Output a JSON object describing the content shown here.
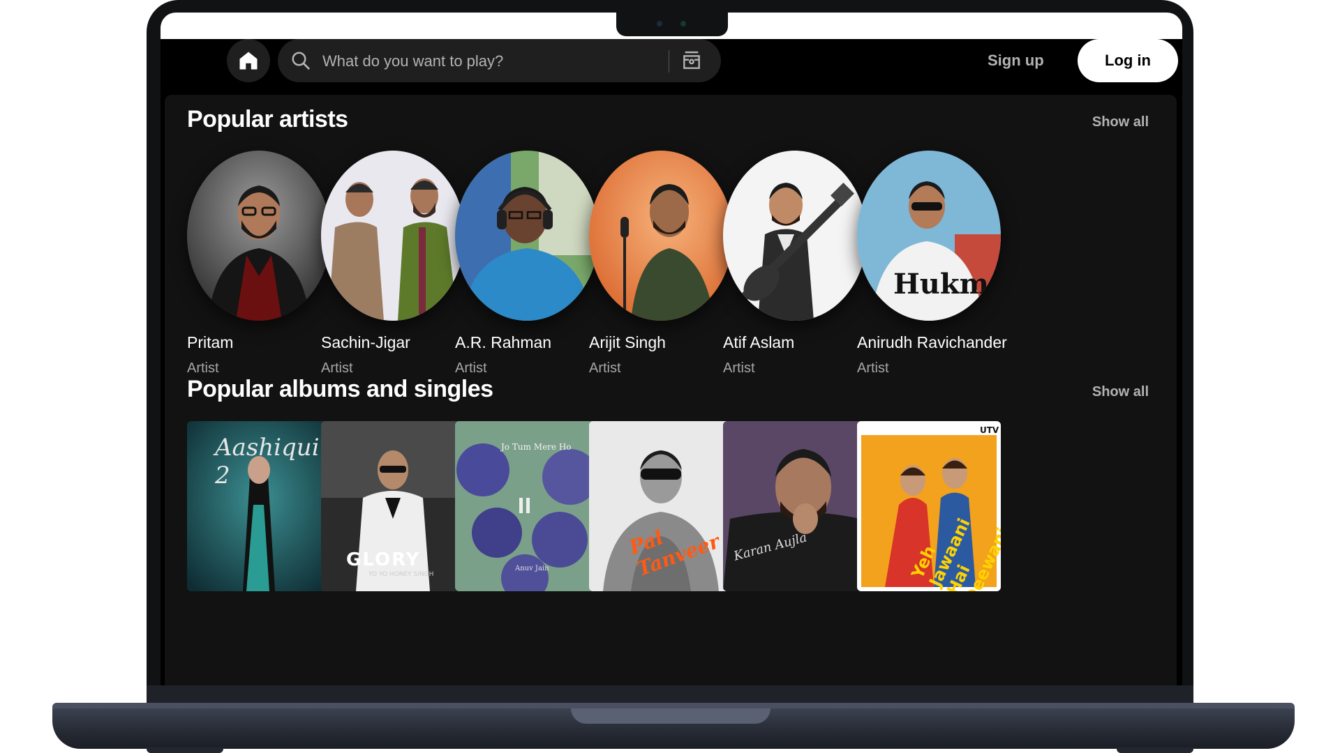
{
  "header": {
    "search_placeholder": "What do you want to play?",
    "signup_label": "Sign up",
    "login_label": "Log in",
    "icons": [
      "home-icon",
      "search-icon",
      "browse-icon"
    ]
  },
  "artists_section": {
    "title": "Popular artists",
    "show_all": "Show all",
    "items": [
      {
        "name": "Pritam",
        "subtitle": "Artist"
      },
      {
        "name": "Sachin-Jigar",
        "subtitle": "Artist"
      },
      {
        "name": "A.R. Rahman",
        "subtitle": "Artist"
      },
      {
        "name": "Arijit Singh",
        "subtitle": "Artist"
      },
      {
        "name": "Atif Aslam",
        "subtitle": "Artist"
      },
      {
        "name": "Anirudh Ravichander",
        "subtitle": "Artist"
      }
    ]
  },
  "albums_section": {
    "title": "Popular albums and singles",
    "show_all": "Show all",
    "covers": [
      {
        "text": "Aashiqui 2"
      },
      {
        "text": "GLORY",
        "subtext": "YO YO HONEY SINGH"
      },
      {
        "text": "Jo Tum Mere Ho",
        "subtext": "Anuv Jain"
      },
      {
        "text": "Pal Tanveer"
      },
      {
        "text": "Karan Aujla"
      },
      {
        "text": "Yeh Jawaani Hai Deewani",
        "subtext": "UTV"
      }
    ]
  },
  "colors": {
    "background": "#000000",
    "panel": "#121212",
    "text_primary": "#ffffff",
    "text_secondary": "#b3b3b3"
  }
}
